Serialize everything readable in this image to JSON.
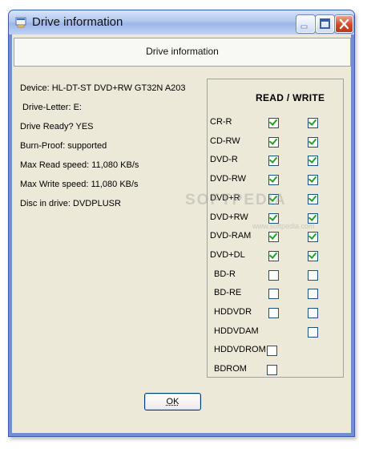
{
  "window": {
    "title": "Drive information",
    "icon": "drive-window-icon"
  },
  "header": {
    "text": "Drive information"
  },
  "info": {
    "device": "Device: HL-DT-ST DVD+RW GT32N    A203",
    "letter": "Drive-Letter: E:",
    "ready": "Drive Ready? YES",
    "burnproof": "Burn-Proof: supported",
    "max_read": "Max Read speed:  11,080 KB/s",
    "max_write": "Max Write speed:  11,080 KB/s",
    "disc": "Disc in drive: DVDPLUSR"
  },
  "rw": {
    "title": "READ / WRITE",
    "drives": [
      {
        "label": "CR-R",
        "read": true,
        "write": true
      },
      {
        "label": "CD-RW",
        "read": true,
        "write": true
      },
      {
        "label": "DVD-R",
        "read": true,
        "write": true
      },
      {
        "label": "DVD-RW",
        "read": true,
        "write": true
      },
      {
        "label": "DVD+R",
        "read": true,
        "write": true
      },
      {
        "label": "DVD+RW",
        "read": true,
        "write": true
      },
      {
        "label": "DVD-RAM",
        "read": true,
        "write": true
      },
      {
        "label": "DVD+DL",
        "read": true,
        "write": true
      },
      {
        "label": "BD-R",
        "read": false,
        "write": false
      },
      {
        "label": "BD-RE",
        "read": false,
        "write": false
      },
      {
        "label": "HDDVDR",
        "read": false,
        "write": false
      },
      {
        "label": "HDDVDAM",
        "read": null,
        "write": false
      },
      {
        "label": "HDDVDROM",
        "read": false,
        "write": null
      },
      {
        "label": "BDROM",
        "read": false,
        "write": null
      }
    ]
  },
  "ok_button": {
    "label": "OK"
  },
  "watermark": {
    "text": "SOFTPEDIA",
    "sub": "www.softpedia.com"
  }
}
